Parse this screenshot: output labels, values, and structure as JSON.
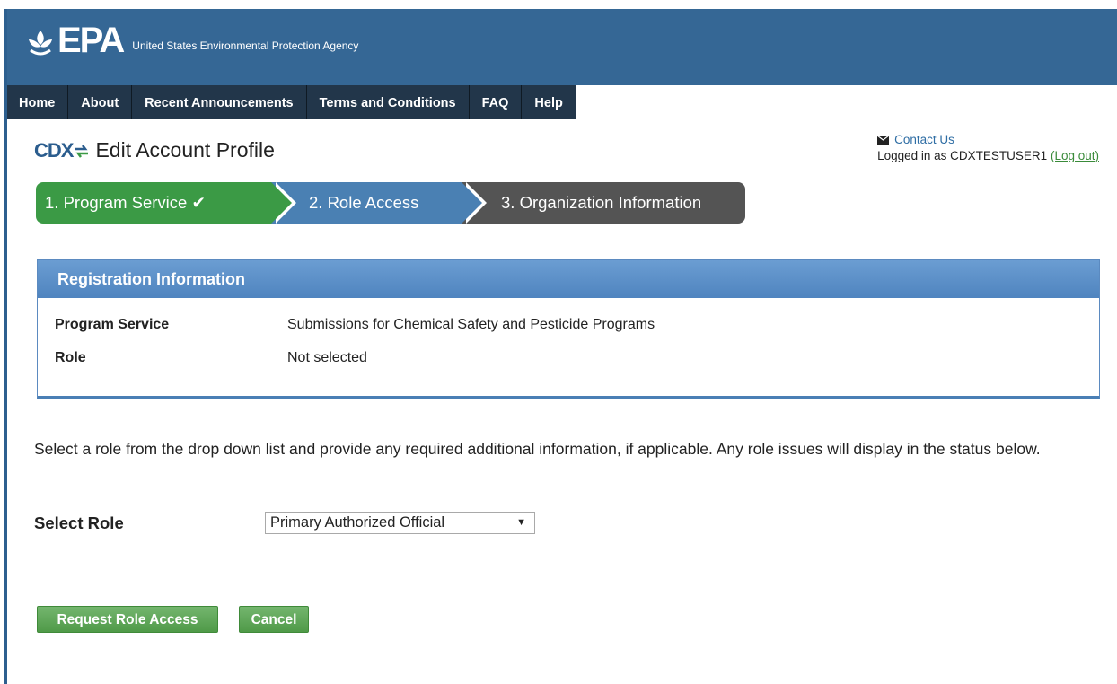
{
  "masthead": {
    "logo": "EPA",
    "agency": "United States Environmental Protection Agency"
  },
  "nav": {
    "items": [
      "Home",
      "About",
      "Recent Announcements",
      "Terms and Conditions",
      "FAQ",
      "Help"
    ]
  },
  "header": {
    "cdx_logo": "CDX",
    "title": "Edit Account Profile",
    "contact_label": "Contact Us",
    "logged_in_prefix": "Logged in as CDXTESTUSER1",
    "logout_label": "(Log out)"
  },
  "steps": {
    "step1": "1. Program Service",
    "step1_check": "✔",
    "step2": "2. Role Access",
    "step3": "3. Organization Information",
    "colors": {
      "complete": "#3b9a45",
      "current": "#4a80b3",
      "upcoming": "#545454"
    }
  },
  "registration": {
    "heading": "Registration Information",
    "program_service_label": "Program Service",
    "program_service_value": "Submissions for Chemical Safety and Pesticide Programs",
    "role_label": "Role",
    "role_value": "Not selected"
  },
  "form": {
    "instructions": "Select a role from the drop down list and provide any required additional information, if applicable. Any role issues will display in the status below.",
    "select_label": "Select Role",
    "select_value": "Primary Authorized Official",
    "select_caret": "▼",
    "request_button": "Request Role Access",
    "cancel_button": "Cancel"
  }
}
